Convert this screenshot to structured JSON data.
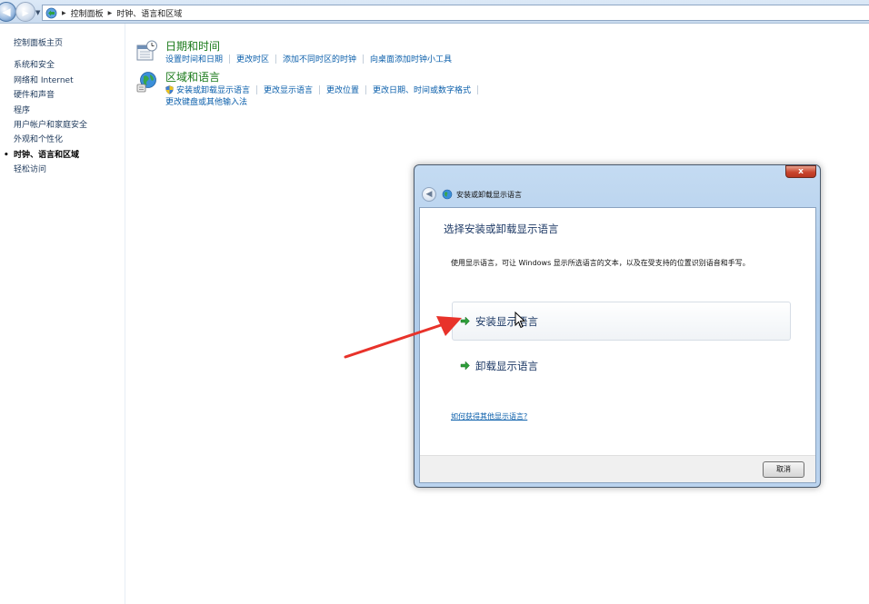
{
  "address_bar": {
    "crumbs": [
      "控制面板",
      "时钟、语言和区域"
    ]
  },
  "sidebar": {
    "home": "控制面板主页",
    "items": [
      {
        "label": "系统和安全"
      },
      {
        "label": "网络和 Internet"
      },
      {
        "label": "硬件和声音"
      },
      {
        "label": "程序"
      },
      {
        "label": "用户帐户和家庭安全"
      },
      {
        "label": "外观和个性化"
      },
      {
        "label": "时钟、语言和区域",
        "active": true
      },
      {
        "label": "轻松访问"
      }
    ]
  },
  "categories": {
    "datetime": {
      "title": "日期和时间",
      "links": [
        "设置时间和日期",
        "更改时区",
        "添加不同时区的时钟",
        "向桌面添加时钟小工具"
      ]
    },
    "region": {
      "title": "区域和语言",
      "links": [
        "安装或卸载显示语言",
        "更改显示语言",
        "更改位置",
        "更改日期、时间或数字格式"
      ],
      "link2": "更改键盘或其他输入法"
    }
  },
  "dialog": {
    "close_label": "x",
    "title": "安装或卸载显示语言",
    "heading": "选择安装或卸载显示语言",
    "description": "使用显示语言，可让 Windows 显示所选语言的文本，以及在受支持的位置识别语音和手写。",
    "option_install": "安装显示语言",
    "option_uninstall": "卸载显示语言",
    "help_link": "如何获得其他显示语言?",
    "cancel_label": "取消"
  },
  "colors": {
    "accent_link": "#0b5fab",
    "category_title": "#1a7a1a",
    "annotation_arrow": "#e8322a"
  }
}
